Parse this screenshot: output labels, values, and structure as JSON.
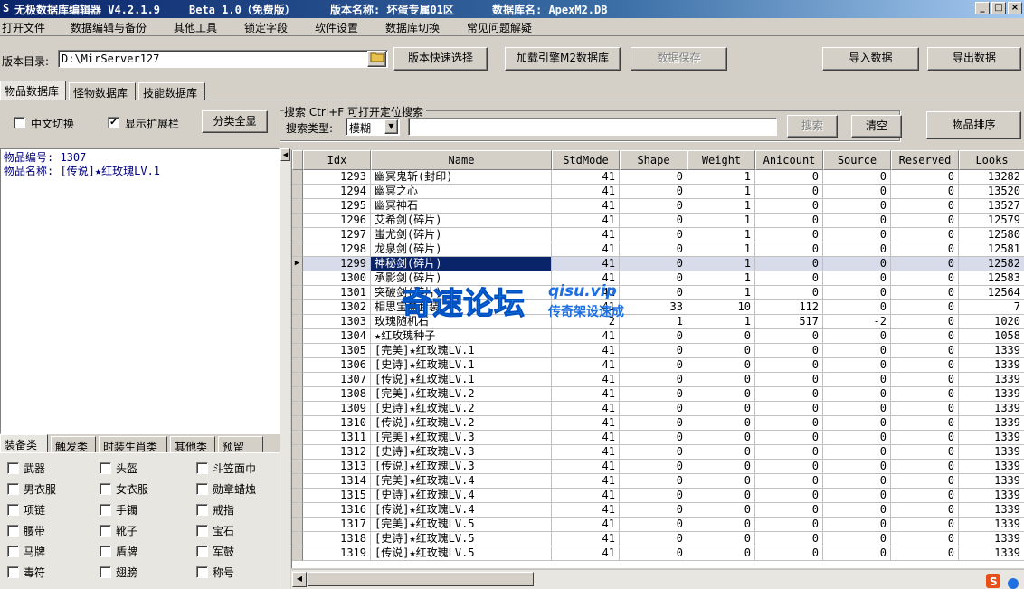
{
  "title": {
    "app": "无极数据库编辑器 V4.2.1.9",
    "edition": "Beta 1.0（免费版）",
    "version_label": "版本名称: 坏蛋专属01区",
    "db_label": "数据库名: ApexM2.DB",
    "icon": "app-s-icon"
  },
  "menu": [
    "打开文件",
    "数据编辑与备份",
    "其他工具",
    "锁定字段",
    "软件设置",
    "数据库切换",
    "常见问题解疑"
  ],
  "toolbar": {
    "dir_label": "版本目录:",
    "dir_value": "D:\\MirServer127",
    "quick_select": "版本快速选择",
    "load_engine": "加载引擎M2数据库",
    "save_data": "数据保存",
    "import_data": "导入数据",
    "export_data": "导出数据"
  },
  "tabs": [
    "物品数据库",
    "怪物数据库",
    "技能数据库"
  ],
  "options": {
    "chinese_switch": "中文切换",
    "chinese_checked": false,
    "show_ext": "显示扩展栏",
    "show_ext_checked": true,
    "show_all": "分类全显"
  },
  "search": {
    "group_title": "搜索  Ctrl+F 可打开定位搜索",
    "type_label": "搜索类型:",
    "type_value": "模糊",
    "query": "",
    "search_btn": "搜索",
    "clear_btn": "清空",
    "sort_btn": "物品排序"
  },
  "info": {
    "id_line": "物品编号: 1307",
    "name_line": "物品名称: [传说]★红玫瑰LV.1"
  },
  "grid": {
    "columns": [
      "Idx",
      "Name",
      "StdMode",
      "Shape",
      "Weight",
      "Anicount",
      "Source",
      "Reserved",
      "Looks"
    ],
    "selected_idx": 1299,
    "rows": [
      [
        1293,
        "幽冥鬼斩(封印)",
        41,
        0,
        1,
        0,
        0,
        0,
        "13282"
      ],
      [
        1294,
        "幽冥之心",
        41,
        0,
        1,
        0,
        0,
        0,
        "13520"
      ],
      [
        1295,
        "幽冥神石",
        41,
        0,
        1,
        0,
        0,
        0,
        "13527"
      ],
      [
        1296,
        "艾希剑(碎片)",
        41,
        0,
        1,
        0,
        0,
        0,
        "12579"
      ],
      [
        1297,
        "蚩尤剑(碎片)",
        41,
        0,
        1,
        0,
        0,
        0,
        "12580"
      ],
      [
        1298,
        "龙泉剑(碎片)",
        41,
        0,
        1,
        0,
        0,
        0,
        "12581"
      ],
      [
        1299,
        "神秘剑(碎片)",
        41,
        0,
        1,
        0,
        0,
        0,
        "12582"
      ],
      [
        1300,
        "承影剑(碎片)",
        41,
        0,
        1,
        0,
        0,
        0,
        "12583"
      ],
      [
        1301,
        "突破剑(碎片)",
        41,
        0,
        1,
        0,
        0,
        0,
        "12564"
      ],
      [
        1302,
        "相思宝盒套装",
        41,
        33,
        10,
        112,
        0,
        0,
        "7"
      ],
      [
        1303,
        "玫瑰随机石",
        2,
        1,
        1,
        517,
        -2,
        0,
        "1020"
      ],
      [
        1304,
        "★红玫瑰种子",
        41,
        0,
        0,
        0,
        0,
        0,
        "1058"
      ],
      [
        1305,
        "[完美]★红玫瑰LV.1",
        41,
        0,
        0,
        0,
        0,
        0,
        "1339"
      ],
      [
        1306,
        "[史诗]★红玫瑰LV.1",
        41,
        0,
        0,
        0,
        0,
        0,
        "1339"
      ],
      [
        1307,
        "[传说]★红玫瑰LV.1",
        41,
        0,
        0,
        0,
        0,
        0,
        "1339"
      ],
      [
        1308,
        "[完美]★红玫瑰LV.2",
        41,
        0,
        0,
        0,
        0,
        0,
        "1339"
      ],
      [
        1309,
        "[史诗]★红玫瑰LV.2",
        41,
        0,
        0,
        0,
        0,
        0,
        "1339"
      ],
      [
        1310,
        "[传说]★红玫瑰LV.2",
        41,
        0,
        0,
        0,
        0,
        0,
        "1339"
      ],
      [
        1311,
        "[完美]★红玫瑰LV.3",
        41,
        0,
        0,
        0,
        0,
        0,
        "1339"
      ],
      [
        1312,
        "[史诗]★红玫瑰LV.3",
        41,
        0,
        0,
        0,
        0,
        0,
        "1339"
      ],
      [
        1313,
        "[传说]★红玫瑰LV.3",
        41,
        0,
        0,
        0,
        0,
        0,
        "1339"
      ],
      [
        1314,
        "[完美]★红玫瑰LV.4",
        41,
        0,
        0,
        0,
        0,
        0,
        "1339"
      ],
      [
        1315,
        "[史诗]★红玫瑰LV.4",
        41,
        0,
        0,
        0,
        0,
        0,
        "1339"
      ],
      [
        1316,
        "[传说]★红玫瑰LV.4",
        41,
        0,
        0,
        0,
        0,
        0,
        "1339"
      ],
      [
        1317,
        "[完美]★红玫瑰LV.5",
        41,
        0,
        0,
        0,
        0,
        0,
        "1339"
      ],
      [
        1318,
        "[史诗]★红玫瑰LV.5",
        41,
        0,
        0,
        0,
        0,
        0,
        "1339"
      ],
      [
        1319,
        "[传说]★红玫瑰LV.5",
        41,
        0,
        0,
        0,
        0,
        0,
        "1339"
      ]
    ]
  },
  "category_tabs": [
    "装备类",
    "触发类",
    "时装生肖类",
    "其他类",
    "预留"
  ],
  "categories": [
    [
      "武器",
      "头盔",
      "斗笠面巾"
    ],
    [
      "男衣服",
      "女衣服",
      "勋章蜡烛"
    ],
    [
      "项链",
      "手镯",
      "戒指"
    ],
    [
      "腰带",
      "靴子",
      "宝石"
    ],
    [
      "马牌",
      "盾牌",
      "军鼓"
    ],
    [
      "毒符",
      "翅膀",
      "称号"
    ]
  ],
  "watermark": {
    "big": "奇速论坛",
    "url": "qisu.vip",
    "sub": "传奇架设速成"
  },
  "colors": {
    "titlebar_start": "#0a246a",
    "selection": "#0a246a",
    "info_text": "#000080",
    "watermark": "#1e90ff"
  }
}
